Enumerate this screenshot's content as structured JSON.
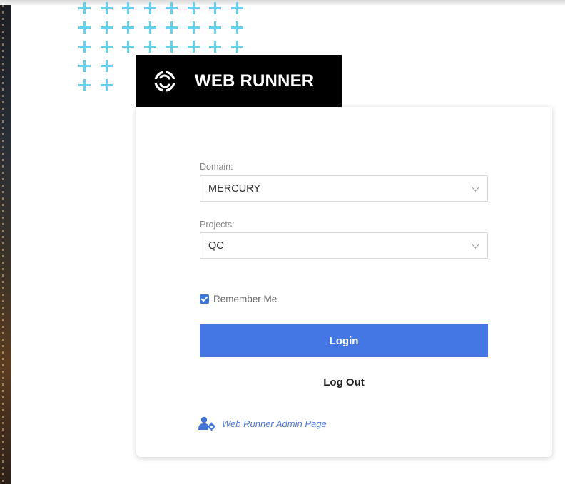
{
  "brand": {
    "name": "WEB RUNNER"
  },
  "form": {
    "domain": {
      "label": "Domain:",
      "value": "MERCURY"
    },
    "project": {
      "label": "Projects:",
      "value": "QC"
    },
    "remember_me": {
      "label": "Remember Me",
      "checked": true
    },
    "login_label": "Login",
    "logout_label": "Log Out",
    "admin_link_label": "Web Runner Admin Page"
  },
  "colors": {
    "accent": "#4477e3",
    "plus_pattern": "#64d2ee",
    "brand_bg": "#000000"
  },
  "icons": [
    "web-runner-logo-icon",
    "chevron-down-icon",
    "checkbox-checked-icon",
    "admin-user-gear-icon"
  ]
}
